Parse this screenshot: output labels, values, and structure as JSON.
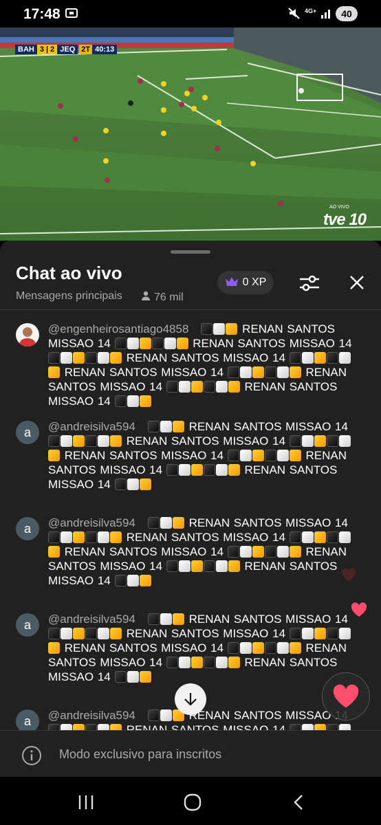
{
  "status_bar": {
    "time": "17:48",
    "network": "4G+",
    "battery": "40",
    "icons": [
      "screenshot-icon",
      "mute-icon",
      "network-4g-icon",
      "signal-icon",
      "battery-icon"
    ]
  },
  "video": {
    "scoreboard": {
      "home": "BAH",
      "score": "3 | 2",
      "away": "JEQ",
      "half": "2T",
      "clock": "40:13"
    },
    "broadcaster_live": "AO VIVO",
    "broadcaster": "tve 10"
  },
  "chat": {
    "title": "Chat ao vivo",
    "mode": "Mensagens principais",
    "viewers": "76 mil",
    "xp": "0 XP",
    "accent_color": "#7c4dff",
    "messages": [
      {
        "author": "@engenheirosantiago4858",
        "avatar_type": "photo",
        "avatar_letter": ""
      },
      {
        "author": "@andreisilva594",
        "avatar_type": "letter",
        "avatar_letter": "a"
      },
      {
        "author": "@andreisilva594",
        "avatar_type": "letter",
        "avatar_letter": "a"
      },
      {
        "author": "@andreisilva594",
        "avatar_type": "letter",
        "avatar_letter": "a"
      },
      {
        "author": "@andreisilva594",
        "avatar_type": "letter",
        "avatar_letter": "a"
      }
    ],
    "phrase": "RENAN SANTOS MISSAO 14",
    "input_placeholder": "Modo exclusivo para inscritos",
    "heart_color": "#ff4d6d"
  },
  "nav": {
    "icons": [
      "recents-icon",
      "home-icon",
      "back-icon"
    ]
  }
}
